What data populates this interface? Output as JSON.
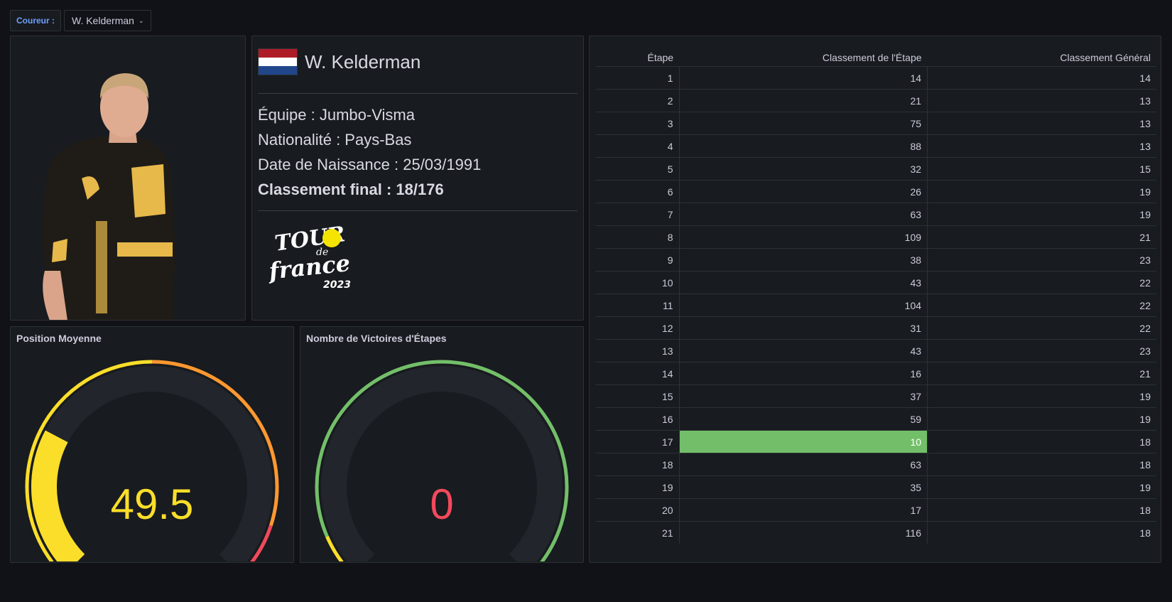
{
  "variable": {
    "label": "Coureur :",
    "value": "W. Kelderman"
  },
  "rider": {
    "name": "W. Kelderman",
    "flag_colors": [
      "#ae1c28",
      "#ffffff",
      "#21468b"
    ],
    "team_line": "Équipe : Jumbo-Visma",
    "nationality_line": "Nationalité : Pays-Bas",
    "birth_line": "Date de Naissance : 25/03/1991",
    "final_line": "Classement final : 18/176",
    "logo_text": {
      "tour": "TOUR",
      "de": "de",
      "france": "france",
      "year": "2023"
    }
  },
  "gauges": [
    {
      "title": "Position Moyenne",
      "value": "49.5",
      "fraction": 0.27,
      "value_color": "#fade2a"
    },
    {
      "title": "Nombre de Victoires d'Étapes",
      "value": "0",
      "fraction": 0.0,
      "value_color": "#f2495c"
    }
  ],
  "table": {
    "headers": [
      "Étape",
      "Classement de l'Étape",
      "Classement Général"
    ],
    "rows": [
      [
        "1",
        "14",
        "14"
      ],
      [
        "2",
        "21",
        "13"
      ],
      [
        "3",
        "75",
        "13"
      ],
      [
        "4",
        "88",
        "13"
      ],
      [
        "5",
        "32",
        "15"
      ],
      [
        "6",
        "26",
        "19"
      ],
      [
        "7",
        "63",
        "19"
      ],
      [
        "8",
        "109",
        "21"
      ],
      [
        "9",
        "38",
        "23"
      ],
      [
        "10",
        "43",
        "22"
      ],
      [
        "11",
        "104",
        "22"
      ],
      [
        "12",
        "31",
        "22"
      ],
      [
        "13",
        "43",
        "23"
      ],
      [
        "14",
        "16",
        "21"
      ],
      [
        "15",
        "37",
        "19"
      ],
      [
        "16",
        "59",
        "19"
      ],
      [
        "17",
        "10",
        "18"
      ],
      [
        "18",
        "63",
        "18"
      ],
      [
        "19",
        "35",
        "19"
      ],
      [
        "20",
        "17",
        "18"
      ],
      [
        "21",
        "116",
        "18"
      ]
    ],
    "highlight_color": "#73bf69"
  }
}
